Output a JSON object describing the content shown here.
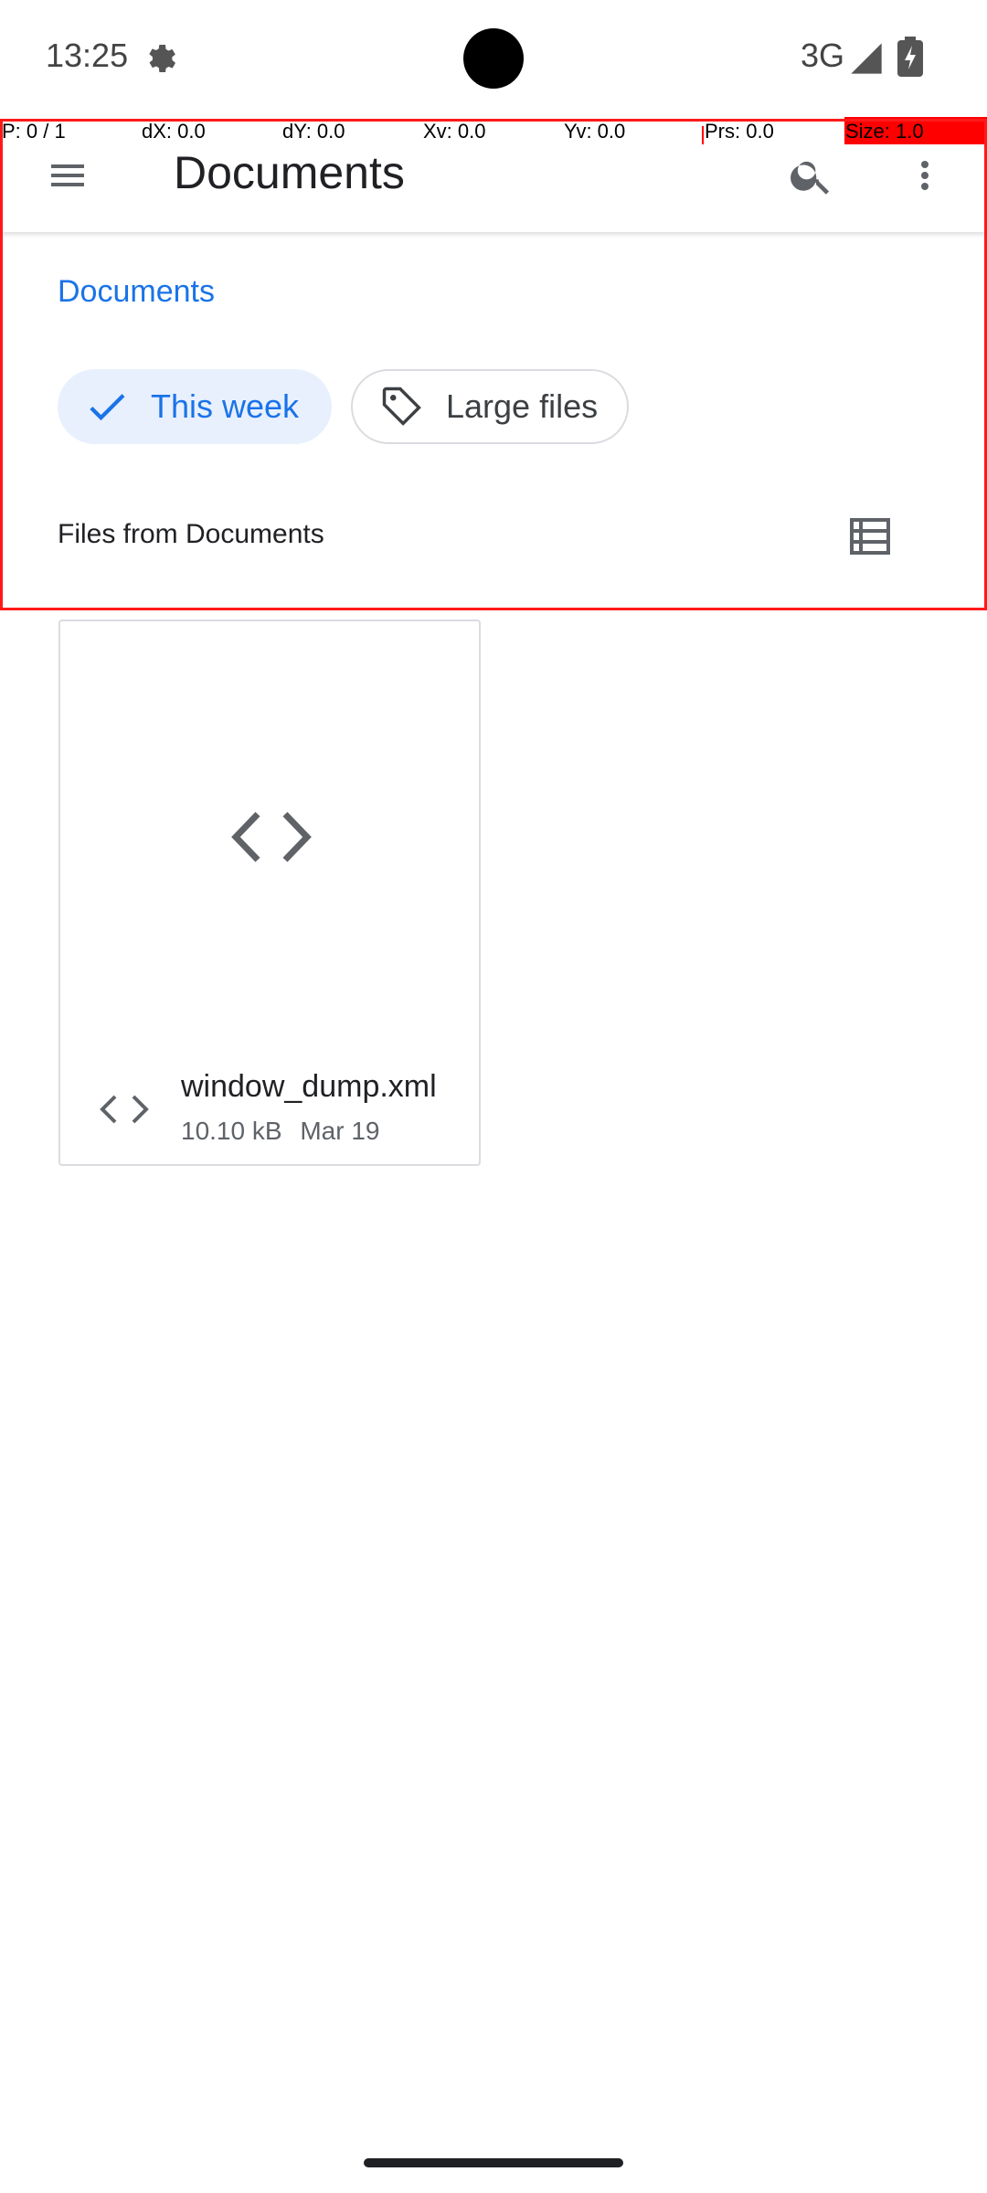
{
  "status_bar": {
    "time": "13:25",
    "network": "3G"
  },
  "pointer_overlay": {
    "pointer": "P: 0 / 1",
    "dx": "dX: 0.0",
    "dy": "dY: 0.0",
    "xv": "Xv: 0.0",
    "yv": "Yv: 0.0",
    "prs": "Prs: 0.0",
    "size": "Size: 1.0"
  },
  "app_bar": {
    "title": "Documents"
  },
  "breadcrumb": "Documents",
  "chips": [
    {
      "label": "This week",
      "selected": true
    },
    {
      "label": "Large files",
      "selected": false
    }
  ],
  "section": {
    "title": "Files from Documents"
  },
  "files": [
    {
      "name": "window_dump.xml",
      "size": "10.10 kB",
      "date": "Mar 19"
    }
  ],
  "colors": {
    "accent": "#1a73e8",
    "chip_selected_bg": "#e8f0fe",
    "debug_frame": "#ff1a1a"
  }
}
